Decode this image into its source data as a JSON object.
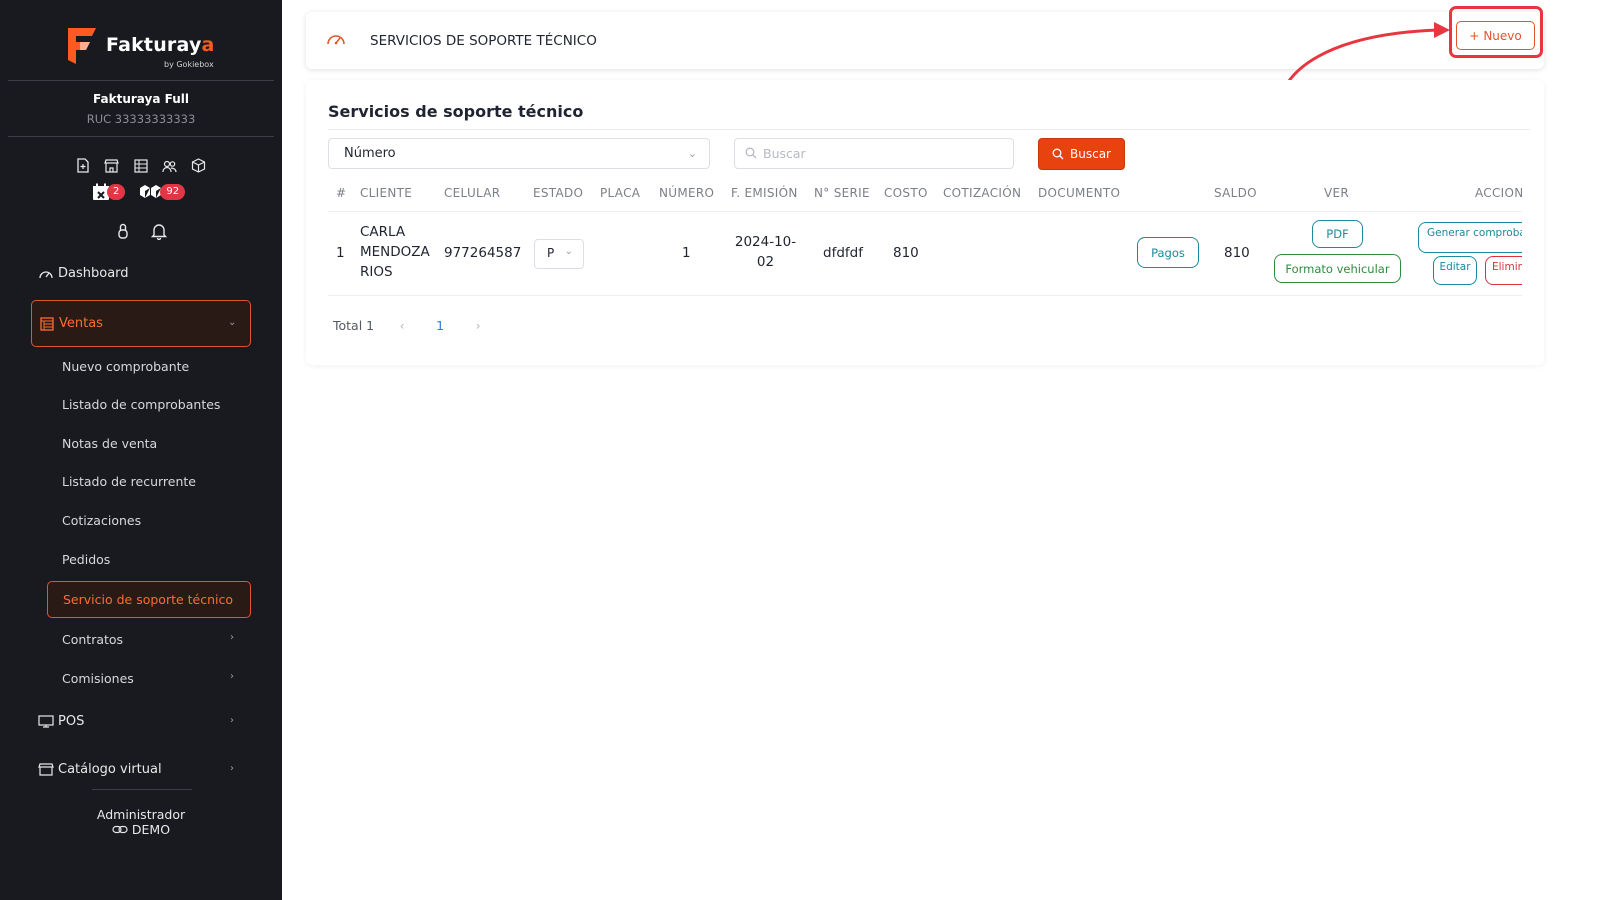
{
  "app": {
    "logo_main": "Fakturay",
    "logo_accent": "a",
    "logo_sub": "by Gokiebox",
    "company": "Fakturaya Full",
    "ruc": "RUC 33333333333",
    "badges": {
      "calendar": "2",
      "boxes": "92"
    }
  },
  "sidebar": {
    "dashboard": "Dashboard",
    "ventas": "Ventas",
    "sub_items": [
      "Nuevo comprobante",
      "Listado de comprobantes",
      "Notas de venta",
      "Listado de recurrente",
      "Cotizaciones",
      "Pedidos",
      "Servicio de soporte técnico",
      "Contratos",
      "Comisiones"
    ],
    "pos": "POS",
    "catalogo": "Catálogo virtual",
    "admin": "Administrador",
    "demo": "DEMO"
  },
  "header": {
    "title": "SERVICIOS DE SOPORTE TÉCNICO",
    "new_button": "Nuevo"
  },
  "content": {
    "title": "Servicios de soporte técnico",
    "filter_select": "Número",
    "search_placeholder": "Buscar",
    "search_button": "Buscar"
  },
  "table": {
    "headers": [
      "#",
      "CLIENTE",
      "CELULAR",
      "ESTADO",
      "PLACA",
      "NÚMERO",
      "F. EMISIÓN",
      "N° SERIE",
      "COSTO",
      "COTIZACIÓN",
      "DOCUMENTO",
      "SALDO",
      "VER",
      "ACCIONES"
    ],
    "rows": [
      {
        "index": "1",
        "cliente": "CARLA MENDOZA RIOS",
        "celular": "977264587",
        "estado": "P",
        "placa": "",
        "numero": "1",
        "emision": "2024-10-02",
        "serie": "dfdfdf",
        "costo": "810",
        "cotizacion": "",
        "documento": "",
        "pagos": "Pagos",
        "saldo": "810",
        "pdf": "PDF",
        "formato": "Formato vehicular",
        "generar": "Generar comprobante",
        "editar": "Editar",
        "eliminar": "Eliminar"
      }
    ]
  },
  "pagination": {
    "total": "Total 1",
    "current": "1"
  },
  "colors": {
    "accent": "#e8430f",
    "sidebar_bg": "#181a1f",
    "teal": "#1a8a9c",
    "green": "#2e8b3e",
    "danger": "#d8323d"
  }
}
